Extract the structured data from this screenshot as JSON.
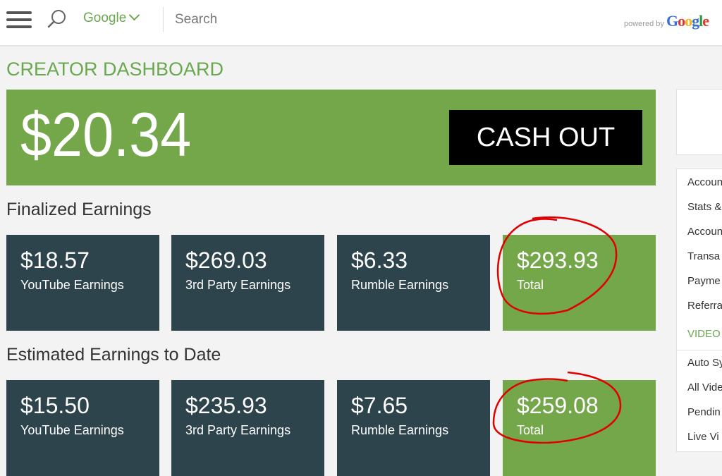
{
  "topbar": {
    "search_engine": "Google",
    "search_placeholder": "Search",
    "powered_by_label": "powered by",
    "powered_by_brand": [
      "G",
      "o",
      "o",
      "g",
      "l",
      "e"
    ],
    "brand_colors": [
      "#3b6fd8",
      "#d93a2f",
      "#f2b515",
      "#3b6fd8",
      "#2e9b45",
      "#d93a2f"
    ]
  },
  "page": {
    "title": "CREATOR DASHBOARD",
    "balance": "$20.34",
    "cash_out_label": "CASH OUT"
  },
  "finalized": {
    "heading": "Finalized Earnings",
    "cards": [
      {
        "value": "$18.57",
        "label": "YouTube Earnings"
      },
      {
        "value": "$269.03",
        "label": "3rd Party Earnings"
      },
      {
        "value": "$6.33",
        "label": "Rumble Earnings"
      },
      {
        "value": "$293.93",
        "label": "Total"
      }
    ]
  },
  "estimated": {
    "heading": "Estimated Earnings to Date",
    "cards": [
      {
        "value": "$15.50",
        "label": "YouTube Earnings"
      },
      {
        "value": "$235.93",
        "label": "3rd Party Earnings"
      },
      {
        "value": "$7.65",
        "label": "Rumble Earnings"
      },
      {
        "value": "$259.08",
        "label": "Total"
      }
    ]
  },
  "sidebar": {
    "items": [
      "Account",
      "Stats &",
      "Account",
      "Transa",
      "Payme",
      "Referra"
    ],
    "section_header": "VIDEO",
    "video_items": [
      "Auto Sy",
      "All Vide",
      "Pendin",
      "Live Vi"
    ]
  },
  "colors": {
    "accent_green": "#74a64a",
    "card_dark": "#2d444d",
    "annotation_red": "#e00000"
  }
}
